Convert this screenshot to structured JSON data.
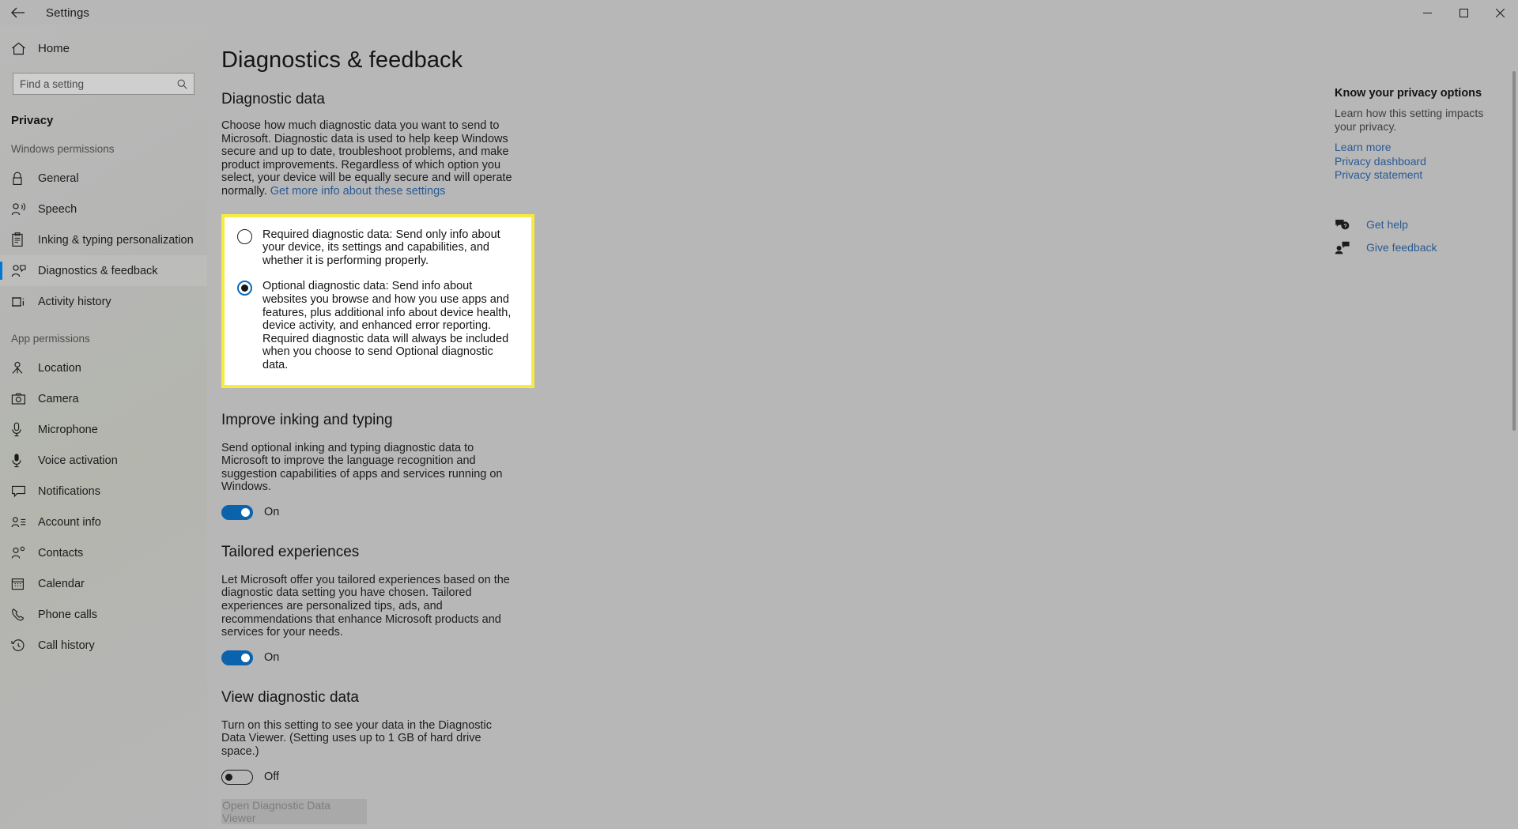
{
  "window": {
    "title": "Settings",
    "back_icon": "back-arrow-icon",
    "minimize_label": "Minimize",
    "maximize_label": "Maximize",
    "close_label": "Close"
  },
  "sidebar": {
    "home_label": "Home",
    "search": {
      "placeholder": "Find a setting",
      "value": "",
      "icon": "search-icon"
    },
    "category_title": "Privacy",
    "groups": [
      {
        "label": "Windows permissions",
        "items": [
          {
            "label": "General",
            "icon": "lock-icon",
            "selected": false
          },
          {
            "label": "Speech",
            "icon": "speech-person-icon",
            "selected": false
          },
          {
            "label": "Inking & typing personalization",
            "icon": "clipboard-pen-icon",
            "selected": false
          },
          {
            "label": "Diagnostics & feedback",
            "icon": "person-feedback-icon",
            "selected": true
          },
          {
            "label": "Activity history",
            "icon": "activity-history-icon",
            "selected": false
          }
        ]
      },
      {
        "label": "App permissions",
        "items": [
          {
            "label": "Location",
            "icon": "location-pin-icon",
            "selected": false
          },
          {
            "label": "Camera",
            "icon": "camera-icon",
            "selected": false
          },
          {
            "label": "Microphone",
            "icon": "microphone-icon",
            "selected": false
          },
          {
            "label": "Voice activation",
            "icon": "voice-activation-icon",
            "selected": false
          },
          {
            "label": "Notifications",
            "icon": "notification-bubble-icon",
            "selected": false
          },
          {
            "label": "Account info",
            "icon": "account-info-icon",
            "selected": false
          },
          {
            "label": "Contacts",
            "icon": "contacts-icon",
            "selected": false
          },
          {
            "label": "Calendar",
            "icon": "calendar-icon",
            "selected": false
          },
          {
            "label": "Phone calls",
            "icon": "phone-icon",
            "selected": false
          },
          {
            "label": "Call history",
            "icon": "call-history-icon",
            "selected": false
          }
        ]
      }
    ]
  },
  "main": {
    "page_title": "Diagnostics & feedback",
    "diagnostic_data": {
      "heading": "Diagnostic data",
      "description": "Choose how much diagnostic data you want to send to Microsoft. Diagnostic data is used to help keep Windows secure and up to date, troubleshoot problems, and make product improvements. Regardless of which option you select, your device will be equally secure and will operate normally.",
      "link_label": "Get more info about these settings",
      "options": [
        {
          "label": "Required diagnostic data: Send only info about your device, its settings and capabilities, and whether it is performing properly.",
          "selected": false
        },
        {
          "label": "Optional diagnostic data: Send info about websites you browse and how you use apps and features, plus additional info about device health, device activity, and enhanced error reporting. Required diagnostic data will always be included when you choose to send Optional diagnostic data.",
          "selected": true
        }
      ]
    },
    "inking": {
      "heading": "Improve inking and typing",
      "description": "Send optional inking and typing diagnostic data to Microsoft to improve the language recognition and suggestion capabilities of apps and services running on Windows.",
      "toggle_state": "On"
    },
    "tailored": {
      "heading": "Tailored experiences",
      "description": "Let Microsoft offer you tailored experiences based on the diagnostic data setting you have chosen. Tailored experiences are personalized tips, ads, and recommendations that enhance Microsoft products and services for your needs.",
      "toggle_state": "On"
    },
    "view_data": {
      "heading": "View diagnostic data",
      "description": "Turn on this setting to see your data in the Diagnostic Data Viewer. (Setting uses up to 1 GB of hard drive space.)",
      "toggle_state": "Off",
      "button_label": "Open Diagnostic Data Viewer"
    }
  },
  "right_rail": {
    "title": "Know your privacy options",
    "description": "Learn how this setting impacts your privacy.",
    "links": [
      "Learn more",
      "Privacy dashboard",
      "Privacy statement"
    ],
    "help": [
      {
        "label": "Get help",
        "icon": "help-bubble-icon"
      },
      {
        "label": "Give feedback",
        "icon": "give-feedback-icon"
      }
    ]
  },
  "colors": {
    "accent": "#0078d4",
    "link": "#2a5a93",
    "highlight": "#f7eb3f",
    "toggle_on": "#0c63ad"
  }
}
